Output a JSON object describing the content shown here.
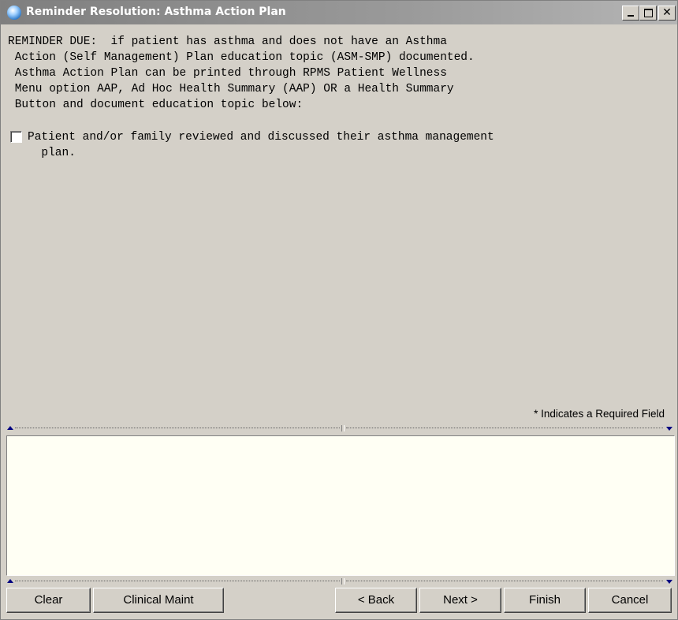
{
  "window": {
    "title": "Reminder Resolution: Asthma Action Plan",
    "app_icon": "globe-icon",
    "controls": {
      "minimize": "minimize-icon",
      "maximize": "maximize-icon",
      "close": "✕"
    }
  },
  "reminder": {
    "text": "REMINDER DUE:  if patient has asthma and does not have an Asthma\n Action (Self Management) Plan education topic (ASM-SMP) documented.\n Asthma Action Plan can be printed through RPMS Patient Wellness\n Menu option AAP, Ad Hoc Health Summary (AAP) OR a Health Summary\n Button and document education topic below:",
    "checkbox_label": "Patient and/or family reviewed and discussed their asthma management\n  plan.",
    "checkbox_checked": false
  },
  "required_note": "* Indicates a Required Field",
  "notes": {
    "value": ""
  },
  "buttons": {
    "clear": "Clear",
    "clinical_maint": "Clinical Maint",
    "back": "< Back",
    "next": "Next >",
    "finish": "Finish",
    "cancel": "Cancel"
  },
  "colors": {
    "face": "#d4d0c8",
    "notes_background": "#fffff4",
    "titlebar": "#8a8a8a"
  }
}
